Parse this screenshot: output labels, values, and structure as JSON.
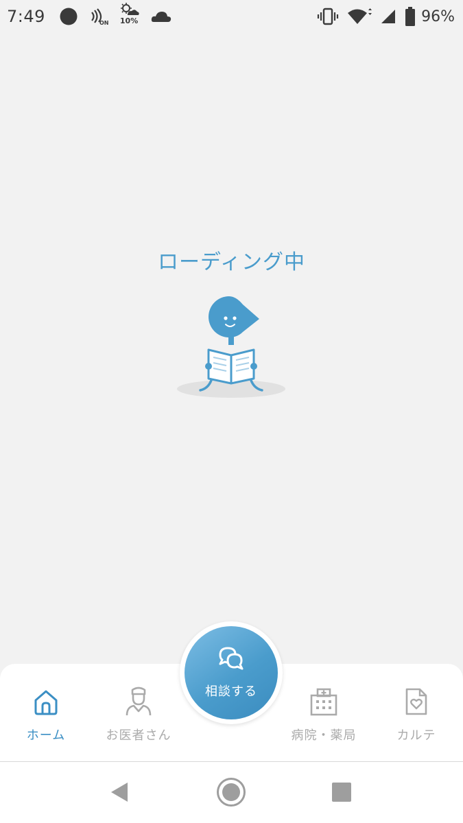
{
  "status_bar": {
    "time": "7:49",
    "weather_percent": "10%",
    "battery_percent": "96%",
    "icons": [
      "circle-notification-icon",
      "nfc-on-icon",
      "weather-icon",
      "cloud-icon",
      "vibrate-icon",
      "wifi-icon",
      "cell-signal-icon",
      "battery-icon"
    ]
  },
  "loading": {
    "text": "ローディング中",
    "image": "mascot-reading-book"
  },
  "consult_button": {
    "label": "相談する",
    "icon": "chat-bubbles-icon"
  },
  "bottom_nav": {
    "items": [
      {
        "label": "ホーム",
        "icon": "home-icon",
        "active": true
      },
      {
        "label": "お医者さん",
        "icon": "doctor-icon",
        "active": false
      },
      {
        "label": "病院・薬局",
        "icon": "hospital-icon",
        "active": false
      },
      {
        "label": "カルテ",
        "icon": "medical-record-icon",
        "active": false
      }
    ]
  },
  "system_nav": {
    "buttons": [
      "back-icon",
      "home-circle-icon",
      "recents-icon"
    ]
  },
  "colors": {
    "accent": "#4a9ccc",
    "active_nav": "#3b8fc4",
    "inactive_nav": "#aaaaaa",
    "background": "#f2f2f2"
  }
}
